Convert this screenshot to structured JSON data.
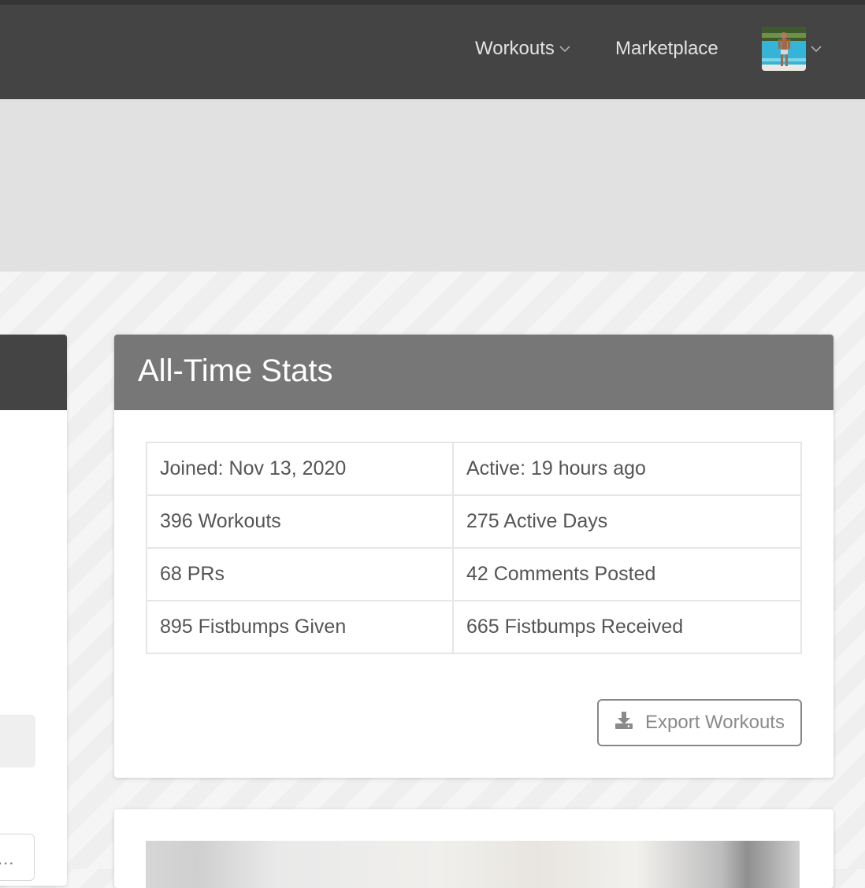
{
  "nav": {
    "items": [
      {
        "label": "Workouts",
        "has_dropdown": true
      },
      {
        "label": "Marketplace",
        "has_dropdown": false
      }
    ],
    "avatar_icon": "user-avatar-photo",
    "avatar_dropdown_icon": "chevron-down-icon"
  },
  "stats_card": {
    "title": "All-Time Stats",
    "rows": [
      [
        "Joined: Nov 13, 2020",
        "Active: 19 hours ago"
      ],
      [
        "396 Workouts",
        "275 Active Days"
      ],
      [
        "68 PRs",
        "42 Comments Posted"
      ],
      [
        "895 Fistbumps Given",
        "665 Fistbumps Received"
      ]
    ],
    "export_button": {
      "label": "Export Workouts",
      "icon": "download-icon"
    }
  },
  "left_panel": {
    "truncated_text": "..."
  },
  "colors": {
    "topbar": "#444444",
    "banner": "#e1e1e1",
    "card_header": "#777777",
    "text": "#555555"
  }
}
